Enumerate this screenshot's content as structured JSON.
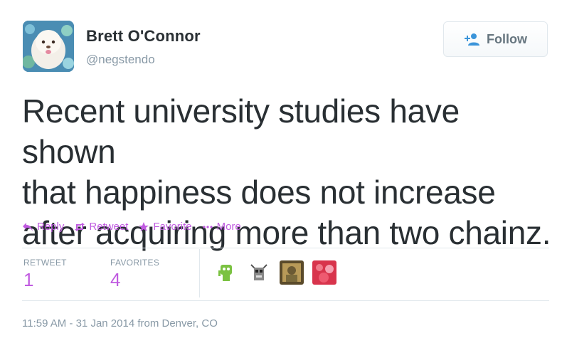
{
  "author": {
    "name": "Brett O'Connor",
    "handle": "@negstendo"
  },
  "follow_button": {
    "label": "Follow",
    "icon": "add-user-icon"
  },
  "tweet": {
    "lines": [
      "Recent university studies have shown",
      "that happiness does not increase",
      "after acquiring more than two chainz."
    ]
  },
  "actions": [
    {
      "label": "Reply",
      "icon": "reply-icon"
    },
    {
      "label": "Retweet",
      "icon": "retweet-icon"
    },
    {
      "label": "Favorite",
      "icon": "star-icon"
    },
    {
      "label": "More",
      "icon": "more-dots-icon"
    }
  ],
  "stats": {
    "retweets": {
      "label": "RETWEET",
      "value": "1"
    },
    "favorites": {
      "label": "FAVORITES",
      "value": "4"
    }
  },
  "favorited_by_count": 4,
  "meta": "11:59 AM - 31 Jan 2014 from Denver, CO",
  "colors": {
    "accent": "#c05be0",
    "text": "#292f33",
    "muted": "#8899a6",
    "border": "#e1e8ed"
  }
}
